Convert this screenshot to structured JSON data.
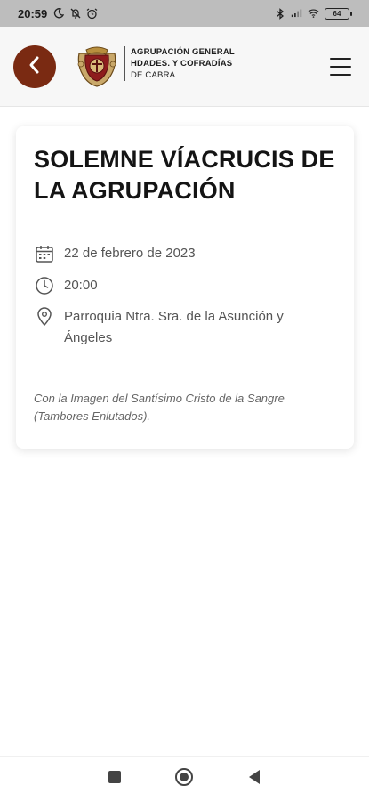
{
  "status_bar": {
    "time": "20:59",
    "battery": "64"
  },
  "header": {
    "brand_line1": "AGRUPACIÓN GENERAL",
    "brand_line2": "HDADES. Y COFRADÍAS",
    "brand_line3": "DE CABRA"
  },
  "event": {
    "title": "SOLEMNE VÍACRUCIS DE LA AGRUPACIÓN",
    "date": "22 de febrero de 2023",
    "time": "20:00",
    "location": "Parroquia Ntra. Sra. de la Asunción y Ángeles",
    "note": "Con la Imagen del Santísimo Cristo de la Sangre (Tambores Enlutados)."
  },
  "colors": {
    "accent": "#7a2a12",
    "status_bar_bg": "#bdbdbd",
    "header_bg": "#f7f7f7"
  },
  "icons": {
    "back": "chevron-left-icon",
    "menu": "hamburger-menu-icon",
    "date": "calendar-icon",
    "time": "clock-icon",
    "location": "map-pin-icon"
  }
}
